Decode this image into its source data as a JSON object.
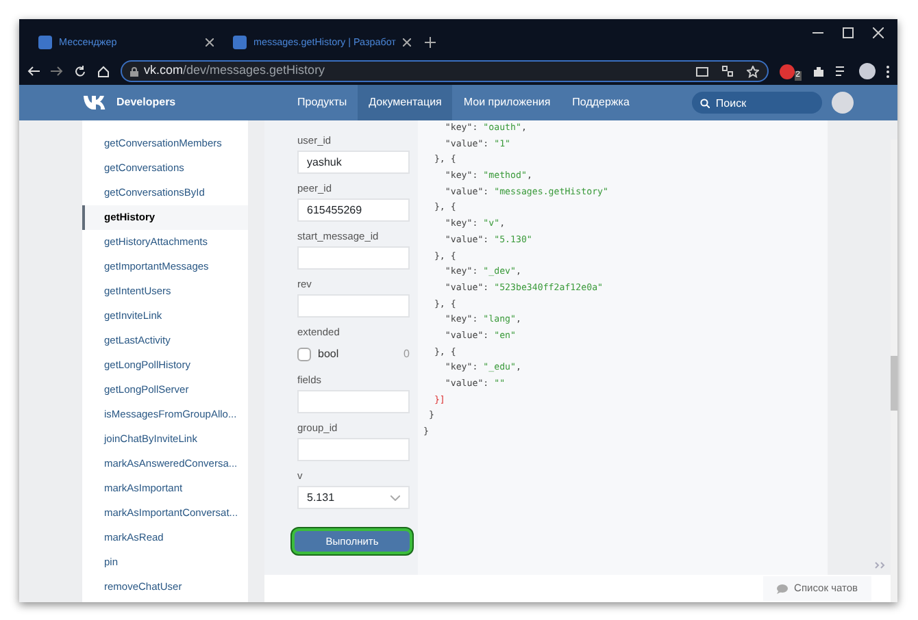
{
  "browser": {
    "tabs": [
      {
        "title": "Мессенджер"
      },
      {
        "title": "messages.getHistory | Разработ"
      }
    ],
    "url": {
      "host": "vk.com",
      "path": "/dev/messages.getHistory"
    },
    "extension_badge": "2"
  },
  "header": {
    "brand": "Developers",
    "nav": [
      {
        "label": "Продукты",
        "selected": false
      },
      {
        "label": "Документация",
        "selected": true
      },
      {
        "label": "Мои приложения",
        "selected": false
      },
      {
        "label": "Поддержка",
        "selected": false
      }
    ],
    "search": {
      "placeholder": "Поиск"
    }
  },
  "sidebar": {
    "items": [
      {
        "label": "getConversationMembers",
        "selected": false
      },
      {
        "label": "getConversations",
        "selected": false
      },
      {
        "label": "getConversationsById",
        "selected": false
      },
      {
        "label": "getHistory",
        "selected": true
      },
      {
        "label": "getHistoryAttachments",
        "selected": false
      },
      {
        "label": "getImportantMessages",
        "selected": false
      },
      {
        "label": "getIntentUsers",
        "selected": false
      },
      {
        "label": "getInviteLink",
        "selected": false
      },
      {
        "label": "getLastActivity",
        "selected": false
      },
      {
        "label": "getLongPollHistory",
        "selected": false
      },
      {
        "label": "getLongPollServer",
        "selected": false
      },
      {
        "label": "isMessagesFromGroupAllo...",
        "selected": false
      },
      {
        "label": "joinChatByInviteLink",
        "selected": false
      },
      {
        "label": "markAsAnsweredConversa...",
        "selected": false
      },
      {
        "label": "markAsImportant",
        "selected": false
      },
      {
        "label": "markAsImportantConversat...",
        "selected": false
      },
      {
        "label": "markAsRead",
        "selected": false
      },
      {
        "label": "pin",
        "selected": false
      },
      {
        "label": "removeChatUser",
        "selected": false
      }
    ]
  },
  "form": {
    "fields": [
      {
        "kind": "text",
        "label": "user_id",
        "value": "yashuk"
      },
      {
        "kind": "text",
        "label": "peer_id",
        "value": "615455269"
      },
      {
        "kind": "text",
        "label": "start_message_id"
      },
      {
        "kind": "text",
        "label": "rev"
      },
      {
        "kind": "checkbox",
        "label": "extended",
        "option": "bool",
        "checked": false,
        "count": "0"
      },
      {
        "kind": "text",
        "label": "fields"
      },
      {
        "kind": "text",
        "label": "group_id"
      },
      {
        "kind": "select",
        "label": "v",
        "value": "5.131"
      }
    ],
    "submit": "Выполнить"
  },
  "response": {
    "lines": [
      [
        {
          "kind": "plain",
          "text": "    \"key\": "
        },
        {
          "kind": "string",
          "text": "\"oauth\""
        },
        {
          "kind": "plain",
          "text": ","
        }
      ],
      [
        {
          "kind": "plain",
          "text": "    \"value\": "
        },
        {
          "kind": "string",
          "text": "\"1\""
        }
      ],
      [
        {
          "kind": "plain",
          "text": "  }, {"
        }
      ],
      [
        {
          "kind": "plain",
          "text": "    \"key\": "
        },
        {
          "kind": "string",
          "text": "\"method\""
        },
        {
          "kind": "plain",
          "text": ","
        }
      ],
      [
        {
          "kind": "plain",
          "text": "    \"value\": "
        },
        {
          "kind": "string",
          "text": "\"messages.getHistory\""
        }
      ],
      [
        {
          "kind": "plain",
          "text": "  }, {"
        }
      ],
      [
        {
          "kind": "plain",
          "text": "    \"key\": "
        },
        {
          "kind": "string",
          "text": "\"v\""
        },
        {
          "kind": "plain",
          "text": ","
        }
      ],
      [
        {
          "kind": "plain",
          "text": "    \"value\": "
        },
        {
          "kind": "string",
          "text": "\"5.130\""
        }
      ],
      [
        {
          "kind": "plain",
          "text": "  }, {"
        }
      ],
      [
        {
          "kind": "plain",
          "text": "    \"key\": "
        },
        {
          "kind": "string",
          "text": "\"_dev\""
        },
        {
          "kind": "plain",
          "text": ","
        }
      ],
      [
        {
          "kind": "plain",
          "text": "    \"value\": "
        },
        {
          "kind": "string",
          "text": "\"523be340ff2af12e0a\""
        }
      ],
      [
        {
          "kind": "plain",
          "text": "  }, {"
        }
      ],
      [
        {
          "kind": "plain",
          "text": "    \"key\": "
        },
        {
          "kind": "string",
          "text": "\"lang\""
        },
        {
          "kind": "plain",
          "text": ","
        }
      ],
      [
        {
          "kind": "plain",
          "text": "    \"value\": "
        },
        {
          "kind": "string",
          "text": "\"en\""
        }
      ],
      [
        {
          "kind": "plain",
          "text": "  }, {"
        }
      ],
      [
        {
          "kind": "plain",
          "text": "    \"key\": "
        },
        {
          "kind": "string",
          "text": "\"_edu\""
        },
        {
          "kind": "plain",
          "text": ","
        }
      ],
      [
        {
          "kind": "plain",
          "text": "    \"value\": "
        },
        {
          "kind": "string",
          "text": "\"\""
        }
      ],
      [
        {
          "kind": "bracket",
          "text": "  }]"
        }
      ],
      [
        {
          "kind": "plain",
          "text": " }"
        }
      ],
      [
        {
          "kind": "plain",
          "text": "}"
        }
      ]
    ]
  },
  "chat_list": {
    "label": "Список чатов"
  }
}
